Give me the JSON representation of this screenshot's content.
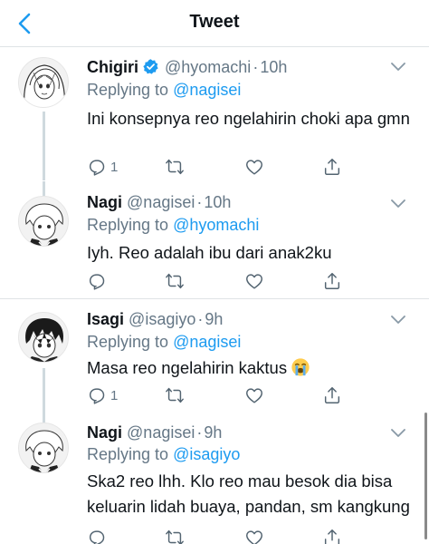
{
  "header": {
    "title": "Tweet",
    "back_icon": "chevron-left-icon",
    "accent": "#1d9bf0"
  },
  "tweets": [
    {
      "name": "Chigiri",
      "verified": true,
      "handle": "@hyomachi",
      "time": "10h",
      "replying_prefix": "Replying to",
      "replying_to": "@nagisei",
      "text": "Ini konsepnya reo ngelahirin choki apa gmn",
      "reply_count": "1",
      "retweet_count": "",
      "like_count": ""
    },
    {
      "name": "Nagi",
      "verified": false,
      "handle": "@nagisei",
      "time": "10h",
      "replying_prefix": "Replying to",
      "replying_to": "@hyomachi",
      "text": "Iyh. Reo adalah ibu dari anak2ku",
      "reply_count": "",
      "retweet_count": "",
      "like_count": ""
    },
    {
      "name": "Isagi",
      "verified": false,
      "handle": "@isagiyo",
      "time": "9h",
      "replying_prefix": "Replying to",
      "replying_to": "@nagisei",
      "text": "Masa reo ngelahirin kaktus",
      "emoji": "loudly-crying-face",
      "reply_count": "1",
      "retweet_count": "",
      "like_count": ""
    },
    {
      "name": "Nagi",
      "verified": false,
      "handle": "@nagisei",
      "time": "9h",
      "replying_prefix": "Replying to",
      "replying_to": "@isagiyo",
      "text": "Ska2 reo lhh. Klo reo mau besok dia bisa keluarin lidah buaya, pandan, sm kangkung",
      "reply_count": "",
      "retweet_count": "",
      "like_count": ""
    }
  ]
}
